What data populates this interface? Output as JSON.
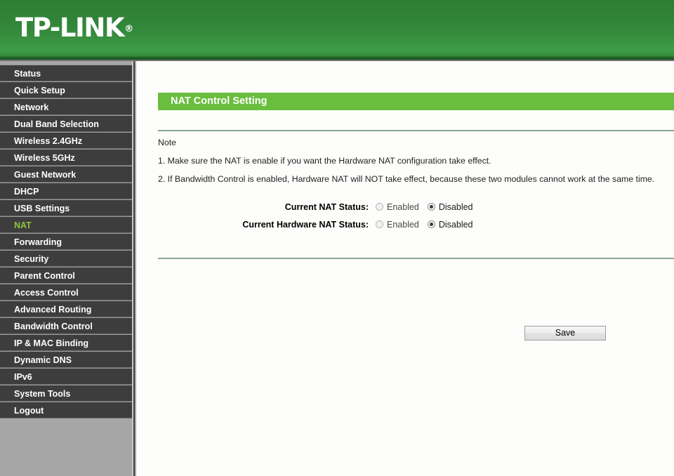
{
  "header": {
    "brand": "TP-LINK",
    "registered_mark": "®"
  },
  "sidebar": {
    "items": [
      {
        "label": "Status",
        "active": false
      },
      {
        "label": "Quick Setup",
        "active": false
      },
      {
        "label": "Network",
        "active": false
      },
      {
        "label": "Dual Band Selection",
        "active": false
      },
      {
        "label": "Wireless 2.4GHz",
        "active": false
      },
      {
        "label": "Wireless 5GHz",
        "active": false
      },
      {
        "label": "Guest Network",
        "active": false
      },
      {
        "label": "DHCP",
        "active": false
      },
      {
        "label": "USB Settings",
        "active": false
      },
      {
        "label": "NAT",
        "active": true
      },
      {
        "label": "Forwarding",
        "active": false
      },
      {
        "label": "Security",
        "active": false
      },
      {
        "label": "Parent Control",
        "active": false
      },
      {
        "label": "Access Control",
        "active": false
      },
      {
        "label": "Advanced Routing",
        "active": false
      },
      {
        "label": "Bandwidth Control",
        "active": false
      },
      {
        "label": "IP & MAC Binding",
        "active": false
      },
      {
        "label": "Dynamic DNS",
        "active": false
      },
      {
        "label": "IPv6",
        "active": false
      },
      {
        "label": "System Tools",
        "active": false
      },
      {
        "label": "Logout",
        "active": false
      }
    ]
  },
  "main": {
    "panel_title": "NAT Control Setting",
    "note": {
      "title": "Note",
      "lines": [
        "1. Make sure the NAT is enable if you want the Hardware NAT configuration take effect.",
        "2. If Bandwidth Control is enabled, Hardware NAT will NOT take effect, because these two modules cannot work at the same time."
      ]
    },
    "settings": [
      {
        "label": "Current NAT Status:",
        "options": [
          {
            "label": "Enabled",
            "selected": false
          },
          {
            "label": "Disabled",
            "selected": true
          }
        ]
      },
      {
        "label": "Current Hardware NAT Status:",
        "options": [
          {
            "label": "Enabled",
            "selected": false
          },
          {
            "label": "Disabled",
            "selected": true
          }
        ]
      }
    ],
    "save_label": "Save"
  },
  "colors": {
    "header_green": "#348a3c",
    "panel_green": "#69be3d",
    "active_item_green": "#8cc63e",
    "sidebar_item_bg": "#3d3d3d",
    "sidebar_bg": "#a6a6a6",
    "content_bg": "#fdfdfb"
  }
}
